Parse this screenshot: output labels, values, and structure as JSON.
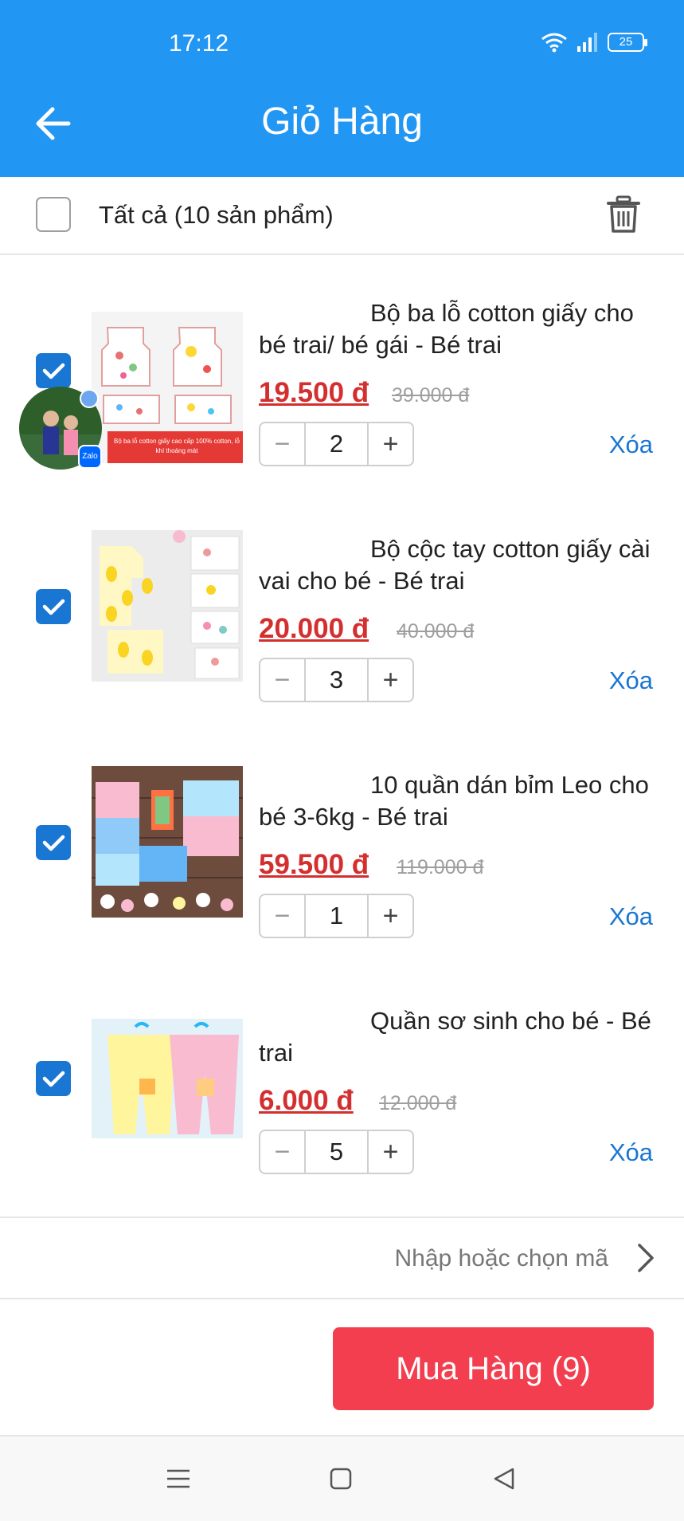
{
  "status_bar": {
    "time": "17:12",
    "battery": "25"
  },
  "header": {
    "title": "Giỏ Hàng"
  },
  "select_all": {
    "label": "Tất cả (10 sản phẩm)"
  },
  "items": [
    {
      "name": "Bộ ba lỗ cotton giấy cho bé trai/ bé gái - Bé trai",
      "price": "19.500 đ",
      "old_price": "39.000 đ",
      "quantity": "2",
      "remove_label": "Xóa",
      "image_caption": "Bộ ba lỗ cotton giấy cao cấp 100% cotton, lỗ khí thoáng mát"
    },
    {
      "name": "Bộ cộc tay cotton giấy cài vai cho bé - Bé trai",
      "price": "20.000 đ",
      "old_price": "40.000 đ",
      "quantity": "3",
      "remove_label": "Xóa"
    },
    {
      "name": "10 quần dán bỉm Leo cho bé 3-6kg - Bé trai",
      "price": "59.500 đ",
      "old_price": "119.000 đ",
      "quantity": "1",
      "remove_label": "Xóa"
    },
    {
      "name": "Quần sơ sinh cho bé - Bé trai",
      "price": "6.000 đ",
      "old_price": "12.000 đ",
      "quantity": "5",
      "remove_label": "Xóa"
    }
  ],
  "voucher": {
    "placeholder": "Nhập hoặc chọn mã"
  },
  "buy_button": {
    "label": "Mua Hàng (9)"
  },
  "zalo": {
    "badge": "Zalo"
  },
  "colors": {
    "primary": "#2196f3",
    "checkbox": "#1976d2",
    "price": "#d32f2f",
    "buy": "#f33e4f"
  },
  "icons": [
    "back-arrow-icon",
    "trash-icon",
    "check-icon",
    "minus-icon",
    "plus-icon",
    "chevron-right-icon",
    "menu-icon",
    "home-icon",
    "back-nav-icon",
    "wifi-icon",
    "signal-icon",
    "battery-icon"
  ]
}
